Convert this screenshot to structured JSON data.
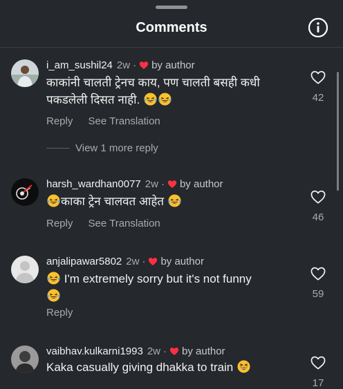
{
  "header": {
    "title": "Comments"
  },
  "comments": [
    {
      "username": "i_am_sushil24",
      "time": "2w",
      "by_author": "by author",
      "text": "काकांनी चालती ट्रेनच काय, पण चालती बसही कधी पकडलेली दिसत नाही. ",
      "reply": "Reply",
      "see_translation": "See Translation",
      "likes": "42",
      "view_more": "View 1 more reply"
    },
    {
      "username": "harsh_wardhan0077",
      "time": "2w",
      "by_author": "by author",
      "text": "काका ट्रेन चालवत आहेत ",
      "reply": "Reply",
      "see_translation": "See Translation",
      "likes": "46"
    },
    {
      "username": "anjalipawar5802",
      "time": "2w",
      "by_author": "by author",
      "text": " I'm extremely sorry but it's not funny",
      "reply": "Reply",
      "likes": "59"
    },
    {
      "username": "vaibhav.kulkarni1993",
      "time": "2w",
      "by_author": "by author",
      "text": "Kaka casually giving dhakka to train ",
      "likes": "17"
    }
  ],
  "colors": {
    "heart": "#ff3040",
    "background": "#25282d",
    "emoji": "#f7c130"
  },
  "icons": [
    "info-icon",
    "heart-icon",
    "laughing-emoji-icon",
    "grinning-squint-emoji-icon"
  ]
}
